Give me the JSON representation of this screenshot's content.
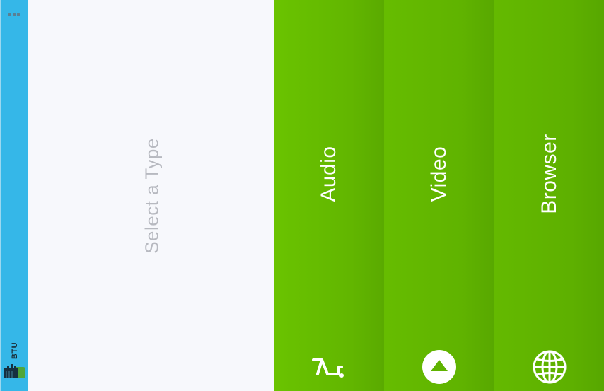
{
  "sidebar": {
    "brand_text": "BTU",
    "logo_icon": "hardhat-logo-icon",
    "menu_icon": "grip-icon",
    "color": "#35b7e8"
  },
  "main": {
    "prompt": "Select a Type"
  },
  "types": [
    {
      "label": "Audio",
      "icon": "sound-wave-icon"
    },
    {
      "label": "Video",
      "icon": "play-triangle-icon"
    },
    {
      "label": "Browser",
      "icon": "globe-icon"
    }
  ],
  "colors": {
    "card_green": "#62b600",
    "main_bg": "#f7f8fc",
    "prompt_text": "#b7b9c0"
  }
}
